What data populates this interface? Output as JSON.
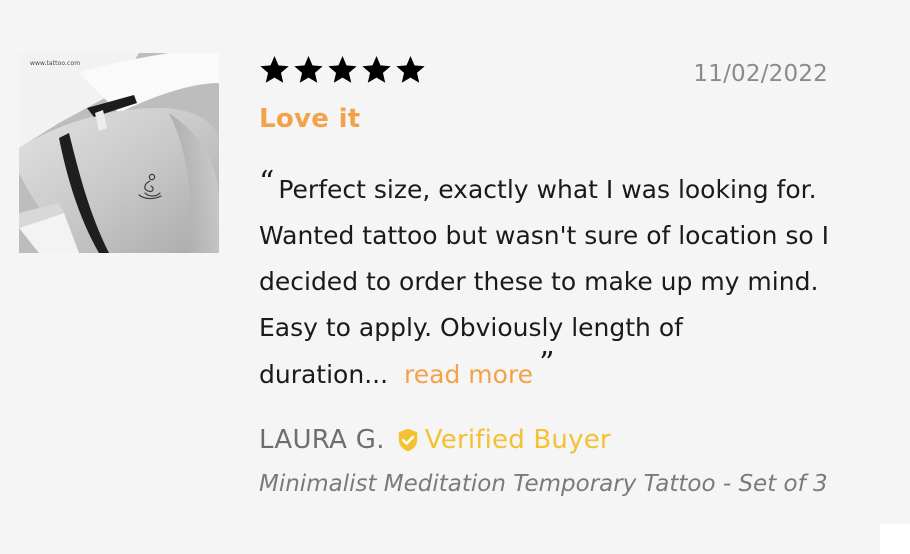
{
  "review": {
    "photo": {
      "watermark": "www.tattoo.com",
      "alt": "tattoo-photo"
    },
    "rating": {
      "stars": 5,
      "max": 5
    },
    "date": "11/02/2022",
    "title": "Love it",
    "body_open_quote": "“",
    "body_text": "Perfect size, exactly what I was looking for. Wanted tattoo but wasn't sure of location so I decided to order these to make up my mind. Easy to apply. Obviously length of duration...",
    "read_more_label": "read more",
    "body_close_quote": "”",
    "author": "LAURA G.",
    "verified_label": "Verified Buyer",
    "product": "Minimalist Meditation Temporary Tattoo - Set of 3"
  },
  "icons": {
    "star": "star-icon",
    "verified": "verified-badge-icon"
  },
  "colors": {
    "title": "#f3a24a",
    "read_more": "#f3a24a",
    "verified": "#f3c131",
    "star": "#000000",
    "date": "#8a8a8a",
    "author": "#6e6e6e",
    "product": "#7a7a7a"
  }
}
